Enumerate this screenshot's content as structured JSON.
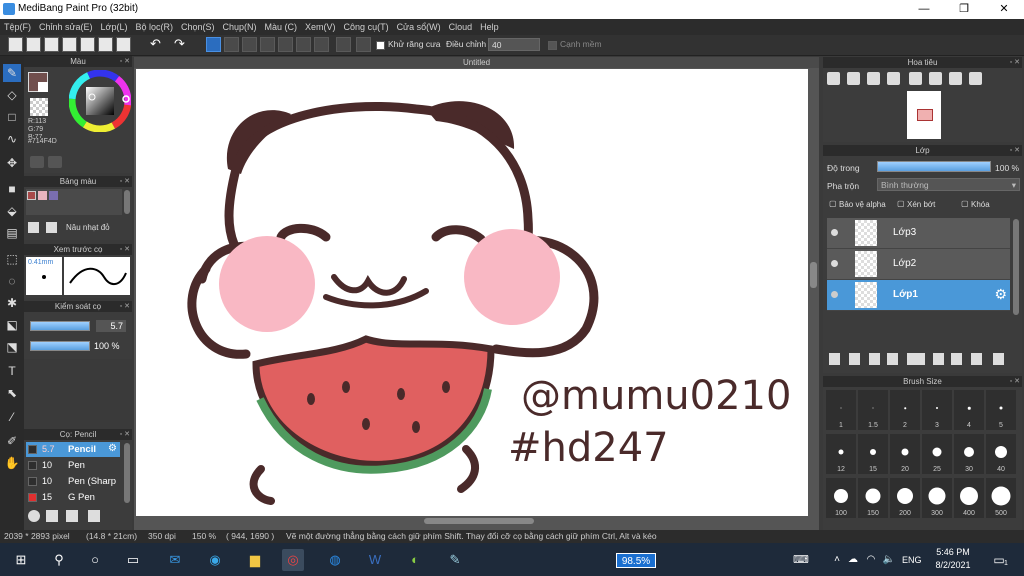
{
  "window": {
    "title": "MediBang Paint Pro (32bit)",
    "min": "—",
    "max": "❐",
    "close": "✕"
  },
  "menu": [
    "Tệp(F)",
    "Chỉnh sửa(E)",
    "Lớp(L)",
    "Bộ lọc(R)",
    "Chọn(S)",
    "Chụp(N)",
    "Màu (C)",
    "Xem(V)",
    "Công cụ(T)",
    "Cửa sổ(W)",
    "Cloud",
    "Help"
  ],
  "toolbar": {
    "antialias_label": "Khử răng cưa",
    "adjust_label": "Điều chỉnh",
    "adjust_value": "40",
    "snap_label": "Cạnh mềm"
  },
  "color_panel": {
    "title": "Màu",
    "r": "R:113",
    "g": "G:79",
    "b": "B:77",
    "hex": "#714F4D",
    "primary_color": "#714F4D"
  },
  "palette_panel": {
    "title": "Bảng màu",
    "swatches": [
      "#a84a4a",
      "#e8b4bf",
      "#7a6eb0"
    ],
    "swatch_name": "Nâu nhạt đỏ"
  },
  "brush_preview_panel": {
    "title": "Xem trước cọ",
    "size": "0.41mm"
  },
  "brush_control_panel": {
    "title": "Kiểm soát cọ",
    "size_value": "5.7",
    "opacity_value": "100 %",
    "size_fraction": 1.0,
    "opacity_fraction": 1.0
  },
  "brush_list_panel": {
    "title": "Cọ: Pencil",
    "items": [
      {
        "size": "5.7",
        "name": "Pencil",
        "color": "#2e2e2e",
        "selected": true
      },
      {
        "size": "10",
        "name": "Pen",
        "color": "#2e2e2e",
        "selected": false
      },
      {
        "size": "10",
        "name": "Pen (Sharp",
        "color": "#2e2e2e",
        "selected": false
      },
      {
        "size": "15",
        "name": "G Pen",
        "color": "#e03030",
        "selected": false
      }
    ]
  },
  "canvas": {
    "tab_title": "Untitled",
    "artwork_text_1": "@mumu0210",
    "artwork_text_2": "#hd247"
  },
  "navigator_panel": {
    "title": "Hoa tiêu"
  },
  "layer_panel": {
    "title": "Lớp",
    "opacity_label": "Độ trong",
    "opacity_value": "100 %",
    "opacity_fraction": 1.0,
    "blend_label": "Pha trộn",
    "blend_value": "Bình thường",
    "protect_alpha": "Bảo vệ alpha",
    "clipping": "Xén bớt",
    "lock": "Khóa",
    "layers": [
      {
        "name": "Lớp3",
        "selected": false
      },
      {
        "name": "Lớp2",
        "selected": false
      },
      {
        "name": "Lớp1",
        "selected": true
      }
    ]
  },
  "brush_size_panel": {
    "title": "Brush Size",
    "sizes": [
      "1",
      "1.5",
      "2",
      "3",
      "4",
      "5",
      "12",
      "15",
      "20",
      "25",
      "30",
      "40",
      "100",
      "150",
      "200",
      "300",
      "400",
      "500"
    ]
  },
  "status": {
    "dimensions": "2039 * 2893 pixel",
    "physical": "(14.8 * 21cm)",
    "dpi": "350 dpi",
    "zoom": "150 %",
    "coords": "( 944, 1690 )",
    "hint": "Vẽ một đường thẳng bằng cách giữ phím Shift. Thay đổi cỡ cọ bằng cách giữ phím Ctrl, Alt và kéo"
  },
  "taskbar": {
    "zoom_badge": "98.5%",
    "lang": "ENG",
    "time": "5:46 PM",
    "date": "8/2/2021",
    "notif_count": "1"
  }
}
